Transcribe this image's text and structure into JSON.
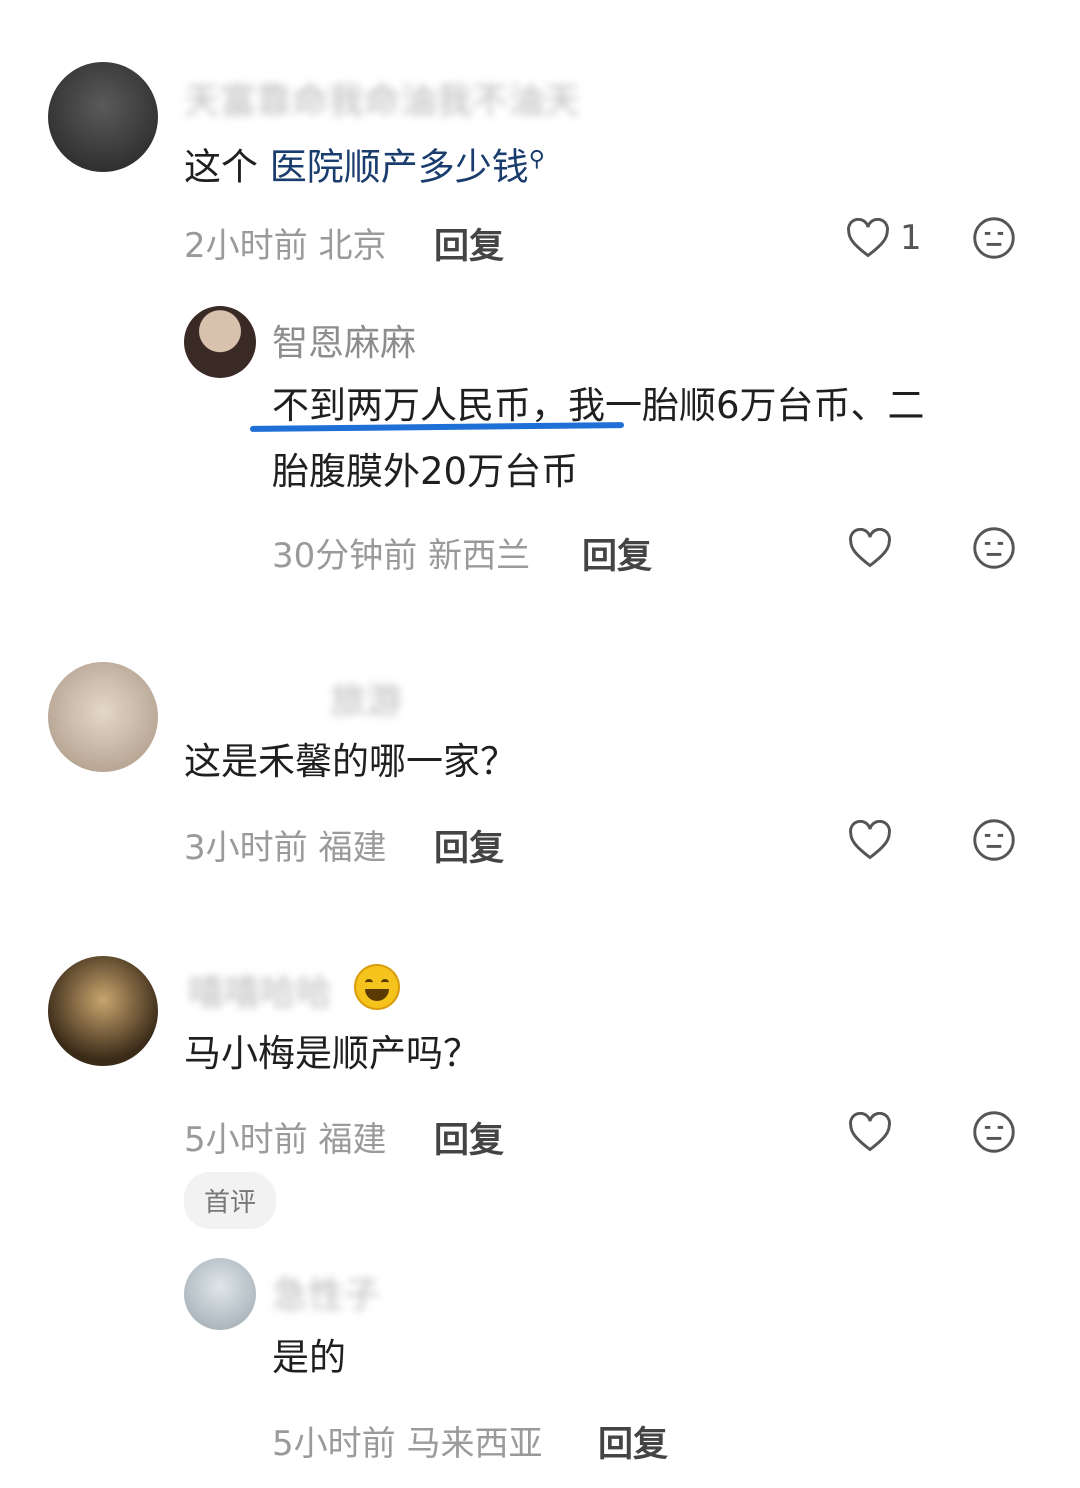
{
  "comments": [
    {
      "username": "天富靠命我命油我不油天",
      "text_prefix": "这个 ",
      "text_link": "医院顺产多少钱",
      "time": "2小时前",
      "location": "北京",
      "reply_label": "回复",
      "like_count": "1"
    },
    {
      "username": "智恩麻麻",
      "line1": "不到两万人民币，我一胎顺6万台币、二",
      "line2": "胎腹膜外20万台币",
      "time": "30分钟前",
      "location": "新西兰",
      "reply_label": "回复"
    },
    {
      "username": "旅游",
      "text": "这是禾馨的哪一家？",
      "time": "3小时前",
      "location": "福建",
      "reply_label": "回复"
    },
    {
      "username": "嘻嘻哈哈",
      "text": "马小梅是顺产吗？",
      "time": "5小时前",
      "location": "福建",
      "reply_label": "回复",
      "tag": "首评"
    },
    {
      "username": "急性子",
      "text": "是的",
      "time": "5小时前",
      "location": "马来西亚",
      "reply_label": "回复"
    }
  ],
  "colors": {
    "underline": "#1e6fd6",
    "link": "#1a3d6e",
    "meta": "#9a9a9a"
  }
}
